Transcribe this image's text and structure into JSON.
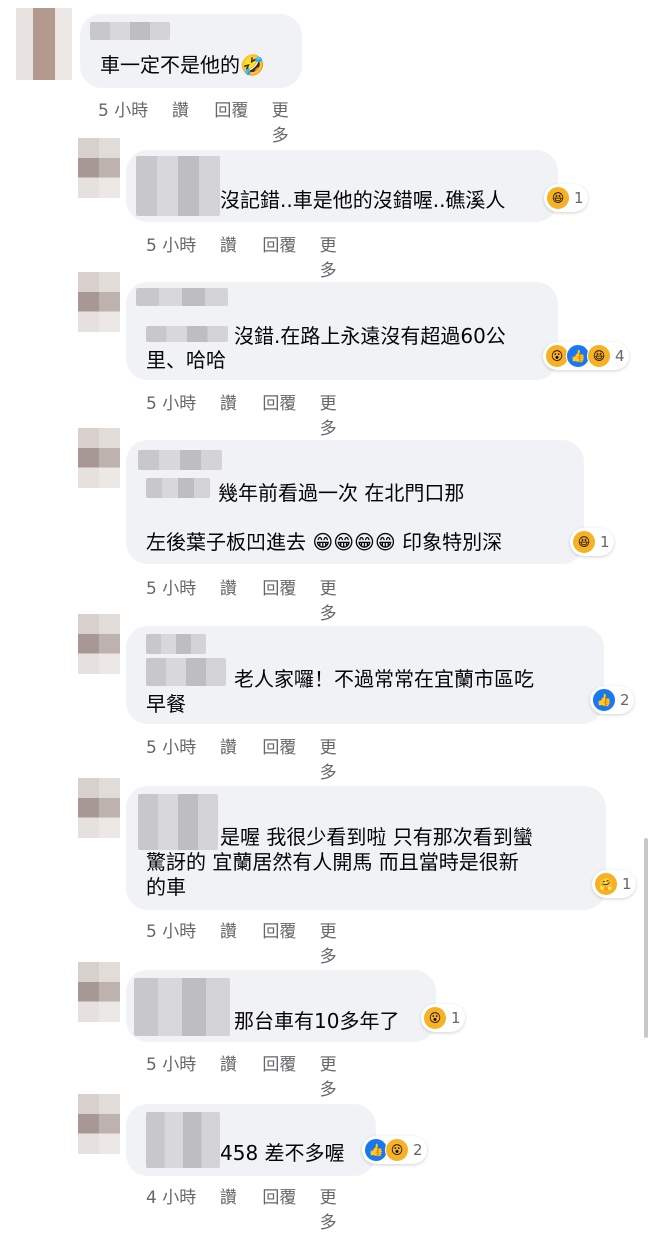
{
  "comments": [
    {
      "text_lines": [
        "車一定不是他的🤣"
      ],
      "reactions": [],
      "count": "",
      "time": "5 小時",
      "actions": [
        "讚",
        "回覆",
        "更多"
      ]
    },
    {
      "text_lines": [
        "沒記錯..車是他的沒錯喔..礁溪人"
      ],
      "reactions": [
        "haha"
      ],
      "count": "1",
      "time": "5 小時",
      "actions": [
        "讚",
        "回覆",
        "更多"
      ]
    },
    {
      "text_lines": [
        "沒錯.在路上永遠沒有超過60公",
        "里、哈哈"
      ],
      "reactions": [
        "wow",
        "like",
        "haha"
      ],
      "count": "4",
      "time": "5 小時",
      "actions": [
        "讚",
        "回覆",
        "更多"
      ]
    },
    {
      "text_lines": [
        "幾年前看過一次 在北門口那",
        "左後葉子板凹進去 😁😁😁😁 印象特別深"
      ],
      "reactions": [
        "haha"
      ],
      "count": "1",
      "time": "5 小時",
      "actions": [
        "讚",
        "回覆",
        "更多"
      ]
    },
    {
      "text_lines": [
        "老人家囉！不過常常在宜蘭市區吃",
        "早餐"
      ],
      "reactions": [
        "like"
      ],
      "count": "2",
      "time": "5 小時",
      "actions": [
        "讚",
        "回覆",
        "更多"
      ]
    },
    {
      "text_lines": [
        "是喔 我很少看到啦 只有那次看到蠻",
        "驚訝的 宜蘭居然有人開馬 而且當時是很新",
        "的車"
      ],
      "reactions": [
        "care"
      ],
      "count": "1",
      "time": "5 小時",
      "actions": [
        "讚",
        "回覆",
        "更多"
      ]
    },
    {
      "text_lines": [
        "那台車有10多年了"
      ],
      "reactions": [
        "wow"
      ],
      "count": "1",
      "time": "5 小時",
      "actions": [
        "讚",
        "回覆",
        "更多"
      ]
    },
    {
      "text_lines": [
        "458 差不多喔"
      ],
      "reactions": [
        "like",
        "wow"
      ],
      "count": "2",
      "time": "4 小時",
      "actions": [
        "讚",
        "回覆",
        "更多"
      ]
    }
  ],
  "icons": {
    "haha": "😆",
    "wow": "😮",
    "like": "👍",
    "care": "🤗"
  },
  "colors": {
    "bubble": "#f0f2f5",
    "meta": "#65676b",
    "like": "#1877f2",
    "emoji": "#f7b125"
  }
}
